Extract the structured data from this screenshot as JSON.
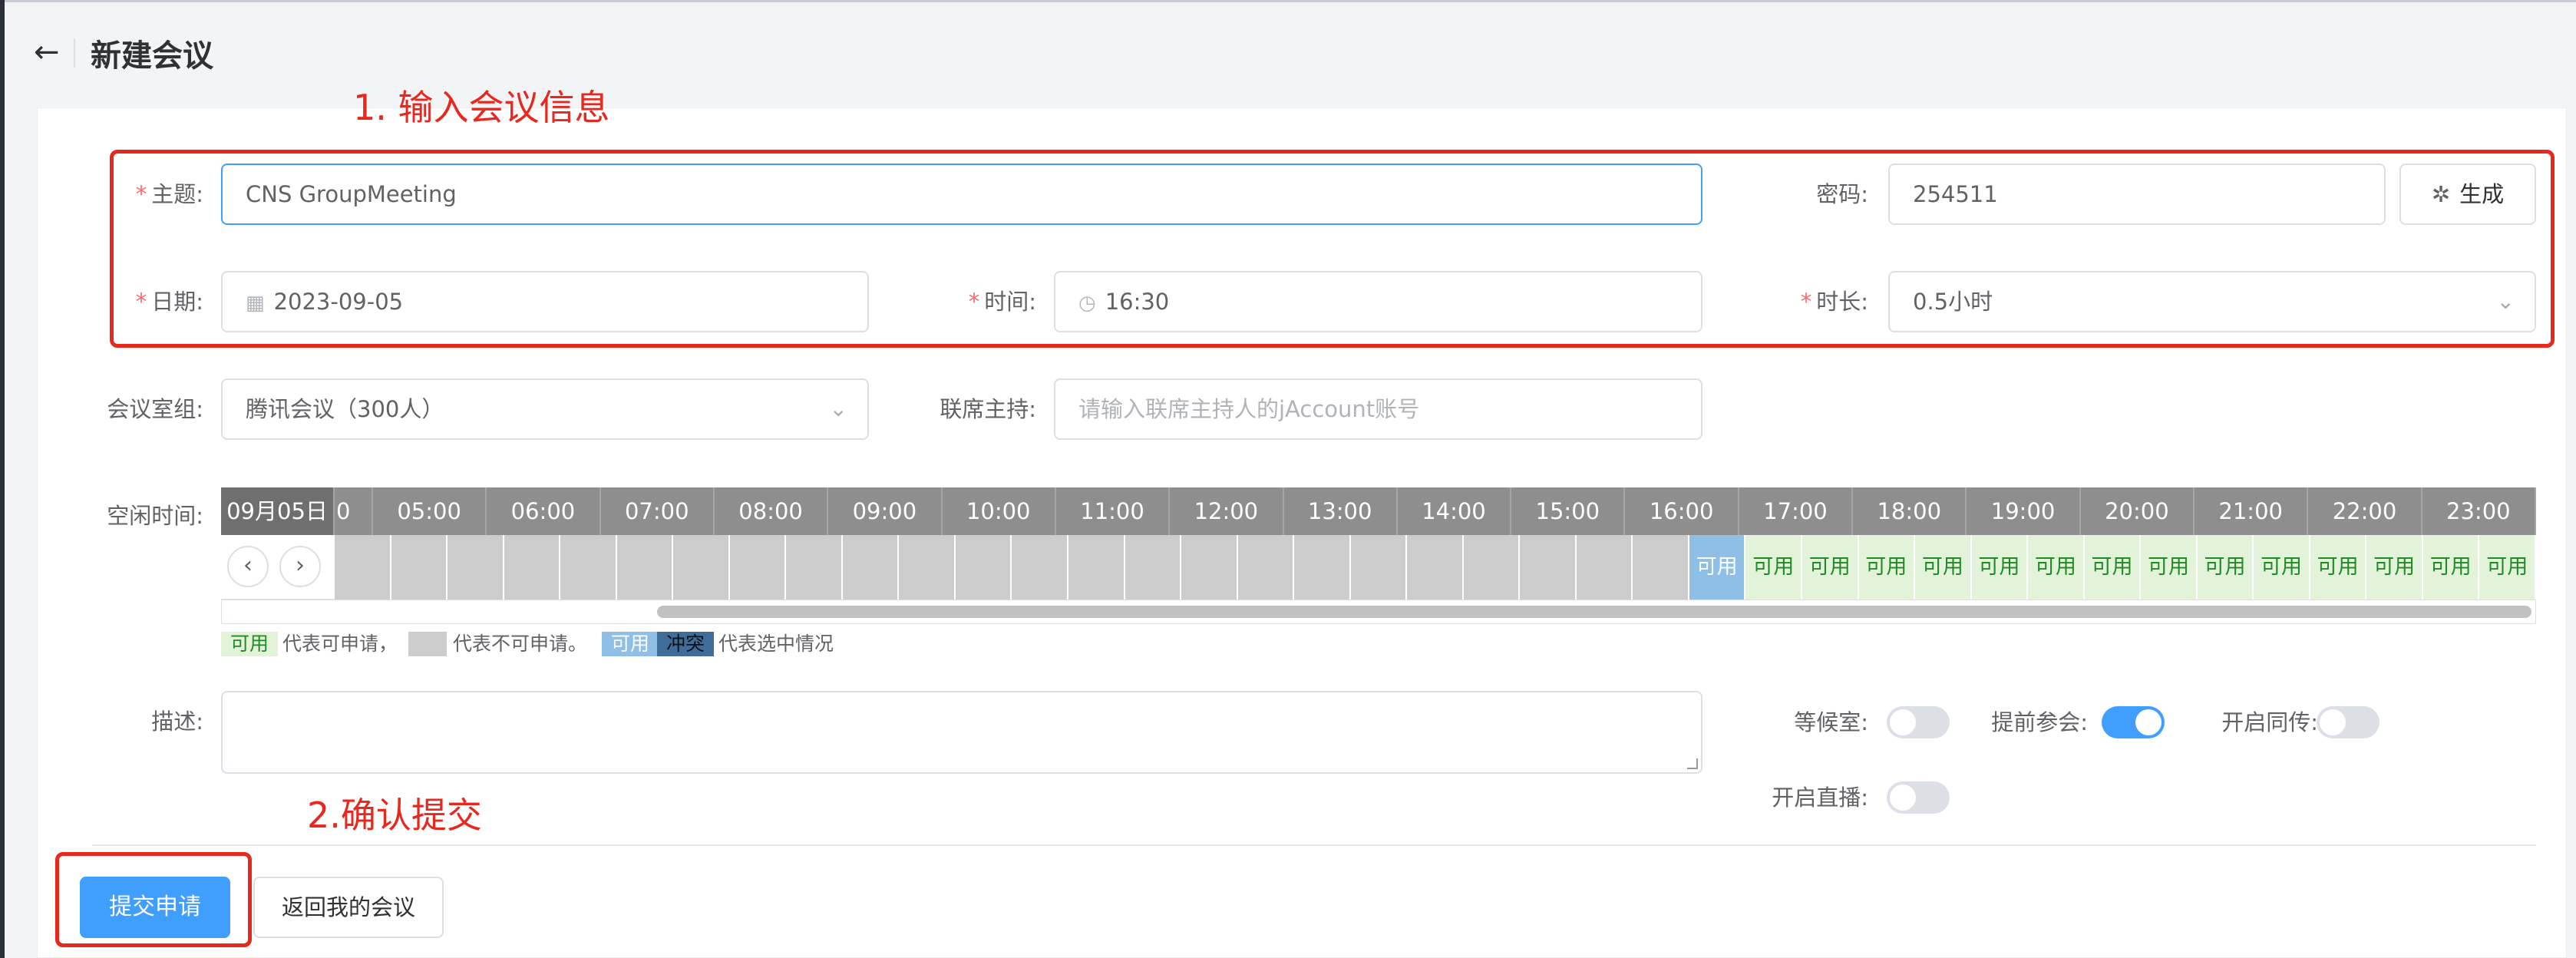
{
  "header": {
    "back_icon": "arrow-left-icon",
    "title": "新建会议"
  },
  "annotations": {
    "step1": "1. 输入会议信息",
    "step2": "2.确认提交"
  },
  "form": {
    "subject": {
      "label": "主题:",
      "value": "CNS GroupMeeting"
    },
    "password": {
      "label": "密码:",
      "value": "254511"
    },
    "generate_button": "生成",
    "date": {
      "label": "日期:",
      "value": "2023-09-05"
    },
    "time": {
      "label": "时间:",
      "value": "16:30"
    },
    "duration": {
      "label": "时长:",
      "value": "0.5小时"
    },
    "room_group": {
      "label": "会议室组:",
      "value": "腾讯会议（300人）"
    },
    "cohost": {
      "label": "联席主持:",
      "placeholder": "请输入联席主持人的jAccount账号"
    },
    "free_time_label": "空闲时间:",
    "description_label": "描述:"
  },
  "schedule": {
    "date_header": "09月05日",
    "hours": [
      "0",
      "05:00",
      "06:00",
      "07:00",
      "08:00",
      "09:00",
      "10:00",
      "11:00",
      "12:00",
      "13:00",
      "14:00",
      "15:00",
      "16:00",
      "17:00",
      "18:00",
      "19:00",
      "20:00",
      "21:00",
      "22:00",
      "23:00"
    ],
    "slot_available_text": "可用",
    "slots_unavailable": 24,
    "slots_selected": 1,
    "slots_available_after": 14
  },
  "legend": {
    "available": "可用",
    "available_text": "代表可申请，",
    "unavailable_text": "代表不可申请。",
    "selected_available": "可用",
    "conflict": "冲突",
    "selected_text": "代表选中情况"
  },
  "switches": {
    "waiting_room": {
      "label": "等候室:",
      "on": false
    },
    "early_join": {
      "label": "提前参会:",
      "on": true
    },
    "simultaneous": {
      "label": "开启同传:",
      "on": false
    },
    "live": {
      "label": "开启直播:",
      "on": false
    }
  },
  "actions": {
    "submit": "提交申请",
    "back": "返回我的会议"
  },
  "colors": {
    "primary": "#409eff",
    "annotation_red": "#e8271f",
    "available_bg": "#e3f3da",
    "unavailable_bg": "#cccccc",
    "selected_bg": "#8fbfe6",
    "conflict_bg": "#3f6d99"
  }
}
